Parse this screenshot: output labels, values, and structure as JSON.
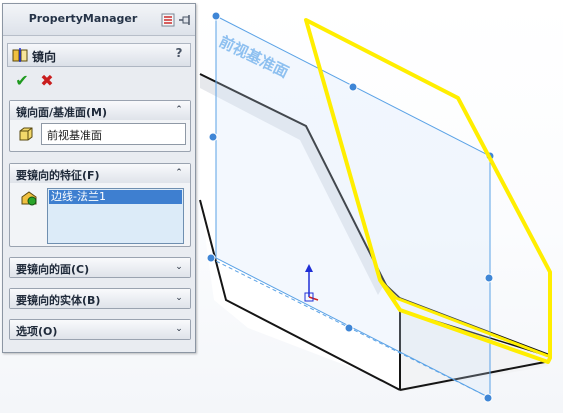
{
  "property_manager": {
    "title": "PropertyManager",
    "feature_name": "镜向",
    "help": "?",
    "ok_glyph": "✔",
    "cancel_glyph": "✖",
    "groups": {
      "mirror_plane": {
        "title": "镜向面/基准面(M)",
        "value": "前视基准面",
        "toggle": "⌃",
        "state": "expanded"
      },
      "features": {
        "title": "要镜向的特征(F)",
        "items": [
          "边线-法兰1"
        ],
        "toggle": "⌃",
        "state": "expanded"
      },
      "faces": {
        "title": "要镜向的面(C)",
        "toggle": "⌄",
        "state": "collapsed"
      },
      "bodies": {
        "title": "要镜向的实体(B)",
        "toggle": "⌄",
        "state": "collapsed"
      },
      "options": {
        "title": "选项(O)",
        "toggle": "⌄",
        "state": "collapsed"
      }
    }
  },
  "viewport": {
    "plane_label": "前视基准面",
    "colors": {
      "highlight": "#ffee00",
      "plane_edge": "#5aa2e6",
      "handle": "#3f86d6",
      "plane_text": "#8ec0f0",
      "triad": "#1f2fd6"
    }
  },
  "icons": [
    "pin-icon",
    "collapse-icon",
    "mirror-feature-icon",
    "plane-icon",
    "feature-icon"
  ]
}
